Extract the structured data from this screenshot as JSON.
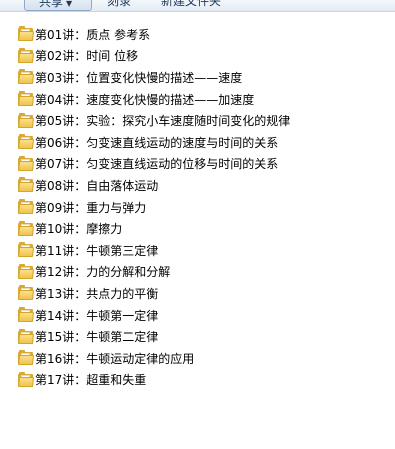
{
  "toolbar": {
    "share_label": "共享",
    "share_arrow": "▼",
    "burn_label": "刻录",
    "new_folder_label": "新建文件夹"
  },
  "icons": {
    "folder": "folder-icon"
  },
  "folders": [
    {
      "label": "第01讲：质点  参考系"
    },
    {
      "label": "第02讲：时间  位移"
    },
    {
      "label": "第03讲：位置变化快慢的描述——速度"
    },
    {
      "label": "第04讲：速度变化快慢的描述——加速度"
    },
    {
      "label": "第05讲：实验：探究小车速度随时间变化的规律"
    },
    {
      "label": "第06讲：匀变速直线运动的速度与时间的关系"
    },
    {
      "label": "第07讲：匀变速直线运动的位移与时间的关系"
    },
    {
      "label": "第08讲：自由落体运动"
    },
    {
      "label": "第09讲：重力与弹力"
    },
    {
      "label": "第10讲：摩擦力"
    },
    {
      "label": "第11讲：牛顿第三定律"
    },
    {
      "label": "第12讲：力的分解和分解"
    },
    {
      "label": "第13讲：共点力的平衡"
    },
    {
      "label": "第14讲：牛顿第一定律"
    },
    {
      "label": "第15讲：牛顿第二定律"
    },
    {
      "label": "第16讲：牛顿运动定律的应用"
    },
    {
      "label": "第17讲：超重和失重"
    }
  ]
}
